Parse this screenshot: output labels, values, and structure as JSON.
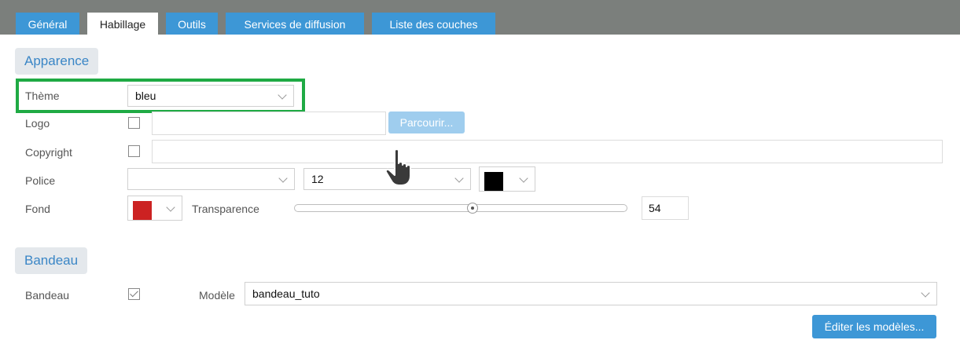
{
  "tabs": [
    {
      "label": "Général"
    },
    {
      "label": "Habillage"
    },
    {
      "label": "Outils"
    },
    {
      "label": "Services de diffusion"
    },
    {
      "label": "Liste des couches"
    }
  ],
  "active_tab": "Habillage",
  "apparence": {
    "section_title": "Apparence",
    "theme": {
      "label": "Thème",
      "value": "bleu"
    },
    "logo": {
      "label": "Logo",
      "checked": false,
      "value": "",
      "browse_label": "Parcourir..."
    },
    "copyright": {
      "label": "Copyright",
      "checked": false,
      "value": ""
    },
    "police": {
      "label": "Police",
      "font_value": "",
      "size_value": "12",
      "color": "#000000"
    },
    "fond": {
      "label": "Fond",
      "color": "#cc2222",
      "transparence_label": "Transparence",
      "transparence_value": "54"
    }
  },
  "bandeau": {
    "section_title": "Bandeau",
    "label": "Bandeau",
    "checked": true,
    "modele_label": "Modèle",
    "modele_value": "bandeau_tuto",
    "edit_label": "Éditer les modèles..."
  },
  "colors": {
    "tabbar": "#7b7f7c",
    "tab": "#3d97d6",
    "accent": "#3a86c6",
    "highlight": "#1faa44"
  },
  "icons": [
    "chevron-down-icon",
    "hand-pointer-icon",
    "checkmark-icon"
  ]
}
